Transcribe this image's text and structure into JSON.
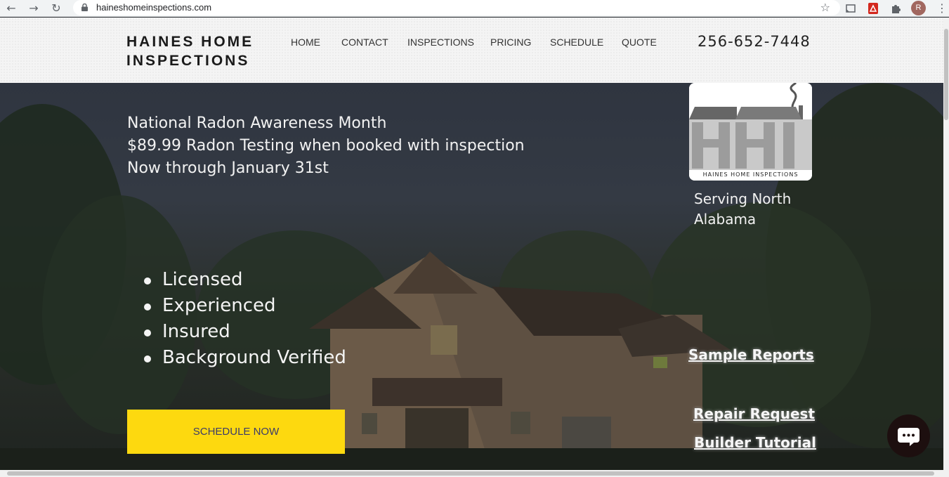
{
  "browser": {
    "url": "haineshomeinspections.com",
    "profile_initial": "R"
  },
  "header": {
    "logo_line1": "HAINES HOME",
    "logo_line2": "INSPECTIONS",
    "nav": [
      "HOME",
      "CONTACT",
      "INSPECTIONS",
      "PRICING",
      "SCHEDULE",
      "QUOTE"
    ],
    "phone": "256-652-7448"
  },
  "hero": {
    "promo": [
      "National Radon Awareness Month",
      "$89.99 Radon Testing when booked with inspection",
      "Now through January 31st"
    ],
    "features": [
      "Licensed",
      "Experienced",
      "Insured",
      "Background Verified"
    ],
    "cta_label": "SCHEDULE NOW",
    "logo_caption": "HAINES HOME INSPECTIONS",
    "serving": "Serving North Alabama",
    "links": {
      "sample_reports": "Sample Reports",
      "repair_request": "Repair Request",
      "builder_tutorial": "Builder Tutorial"
    }
  },
  "colors": {
    "cta": "#fdd90f",
    "cta_text": "#3b3b6b",
    "header_bg": "#f4f4f4"
  }
}
